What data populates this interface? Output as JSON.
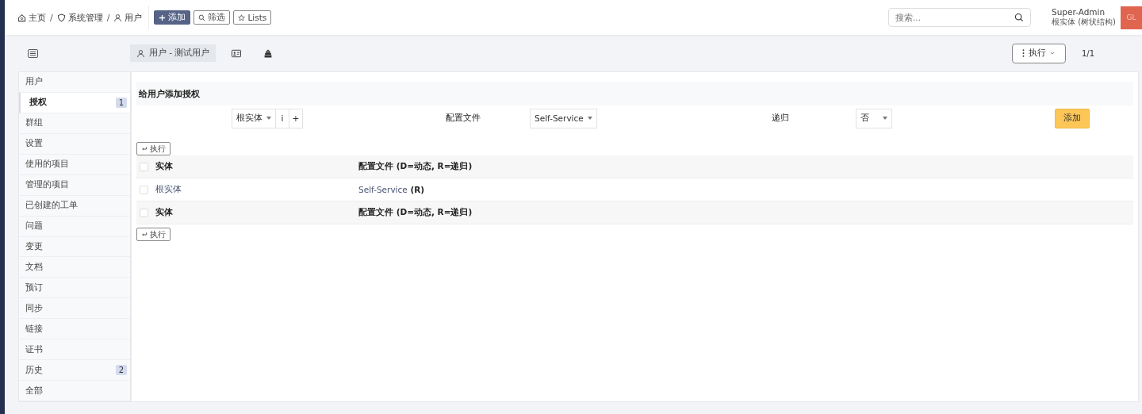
{
  "breadcrumb": [
    {
      "label": "主页",
      "separator": "/"
    },
    {
      "label": "系统管理",
      "separator": "/"
    },
    {
      "label": "用户"
    }
  ],
  "toolbar": [
    {
      "label": "添加",
      "kind": "primary"
    },
    {
      "label": "筛选",
      "kind": "outline"
    },
    {
      "label": "Lists",
      "kind": "outline"
    }
  ],
  "search": {
    "placeholder": "搜索..."
  },
  "user": {
    "name": "Super-Admin",
    "entity": "根实体 (树状结构)",
    "initials": "GL"
  },
  "tabs": [
    {
      "label": "用户 - 测试用户",
      "kind": "user",
      "selected": true
    },
    {
      "kind": "card",
      "selected": false
    },
    {
      "kind": "tree",
      "selected": false
    }
  ],
  "actions_button": "执行",
  "pager": "1/1",
  "sidebar": {
    "items": [
      {
        "label": "用户",
        "selected": false
      },
      {
        "label": "授权",
        "selected": true,
        "badge": "1"
      },
      {
        "label": "群组",
        "selected": false
      },
      {
        "label": "设置",
        "selected": false
      },
      {
        "label": "使用的项目",
        "selected": false
      },
      {
        "label": "管理的项目",
        "selected": false
      },
      {
        "label": "已创建的工单",
        "selected": false
      },
      {
        "label": "问题",
        "selected": false
      },
      {
        "label": "变更",
        "selected": false
      },
      {
        "label": "文档",
        "selected": false
      },
      {
        "label": "预订",
        "selected": false
      },
      {
        "label": "同步",
        "selected": false
      },
      {
        "label": "链接",
        "selected": false
      },
      {
        "label": "证书",
        "selected": false
      },
      {
        "label": "历史",
        "selected": false,
        "badge": "2"
      },
      {
        "label": "全部",
        "selected": false
      }
    ]
  },
  "form": {
    "title": "给用户添加授权",
    "entity": "根实体",
    "info": "i",
    "add_entity": "+",
    "profile_label": "配置文件",
    "profile": "Self-Service",
    "recursive_label": "递归",
    "recursive": "否",
    "submit": "添加"
  },
  "mass_action_top": "执行",
  "mass_action_bottom": "执行",
  "table": {
    "columns": [
      "实体",
      "配置文件 (D=动态, R=递归)"
    ],
    "header_checked": false,
    "footer_checked": false,
    "rows": [
      {
        "entity": "根实体",
        "profile": "Self-Service",
        "flag": " (R)",
        "checked": false
      }
    ],
    "footer": [
      "实体",
      "配置文件 (D=动态, R=递归)"
    ]
  }
}
